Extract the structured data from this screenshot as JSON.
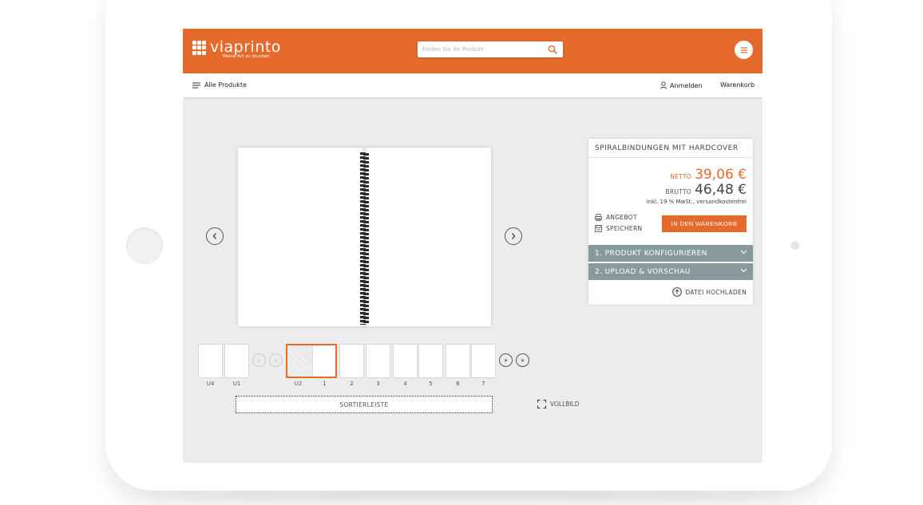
{
  "brand": {
    "name": "viaprinto",
    "tagline": "Meine Art zu drucken."
  },
  "search": {
    "placeholder": "Finden Sie Ihr Produkt"
  },
  "nav": {
    "all_products": "Alle Produkte",
    "login": "Anmelden",
    "cart": "Warenkorb"
  },
  "thumbnails": {
    "items": [
      {
        "label": "U4"
      },
      {
        "label": "U1"
      },
      {
        "label": "U2"
      },
      {
        "label": "1"
      },
      {
        "label": "2"
      },
      {
        "label": "3"
      },
      {
        "label": "4"
      },
      {
        "label": "5"
      },
      {
        "label": "6"
      },
      {
        "label": "7"
      }
    ],
    "sort_bar": "SORTIERLEISTE",
    "fullscreen": "VOLLBILD"
  },
  "panel": {
    "title": "SPIRALBINDUNGEN MIT HARDCOVER",
    "netto_label": "NETTO",
    "netto_value": "39,06 €",
    "brutto_label": "BRUTTO",
    "brutto_value": "46,48 €",
    "price_note": "inkl. 19 % MwSt., versandkostenfrei",
    "offer_label": "ANGEBOT",
    "save_label": "SPEICHERN",
    "cart_button": "IN DEN WARENKORB",
    "step1": "1. PRODUKT KONFIGURIEREN",
    "step2": "2. UPLOAD & VORSCHAU",
    "upload_label": "DATEI HOCHLADEN"
  },
  "colors": {
    "accent": "#e56a2c",
    "accordion": "#889a9b",
    "screen_bg": "#ececec"
  },
  "icons": [
    "search-icon",
    "hamburger-icon",
    "user-icon",
    "arrow-left-icon",
    "arrow-right-icon",
    "first-page-icon",
    "prev-page-icon",
    "next-page-icon",
    "last-page-icon",
    "fullscreen-icon",
    "offer-icon",
    "save-icon",
    "chevron-down-icon",
    "upload-icon"
  ]
}
